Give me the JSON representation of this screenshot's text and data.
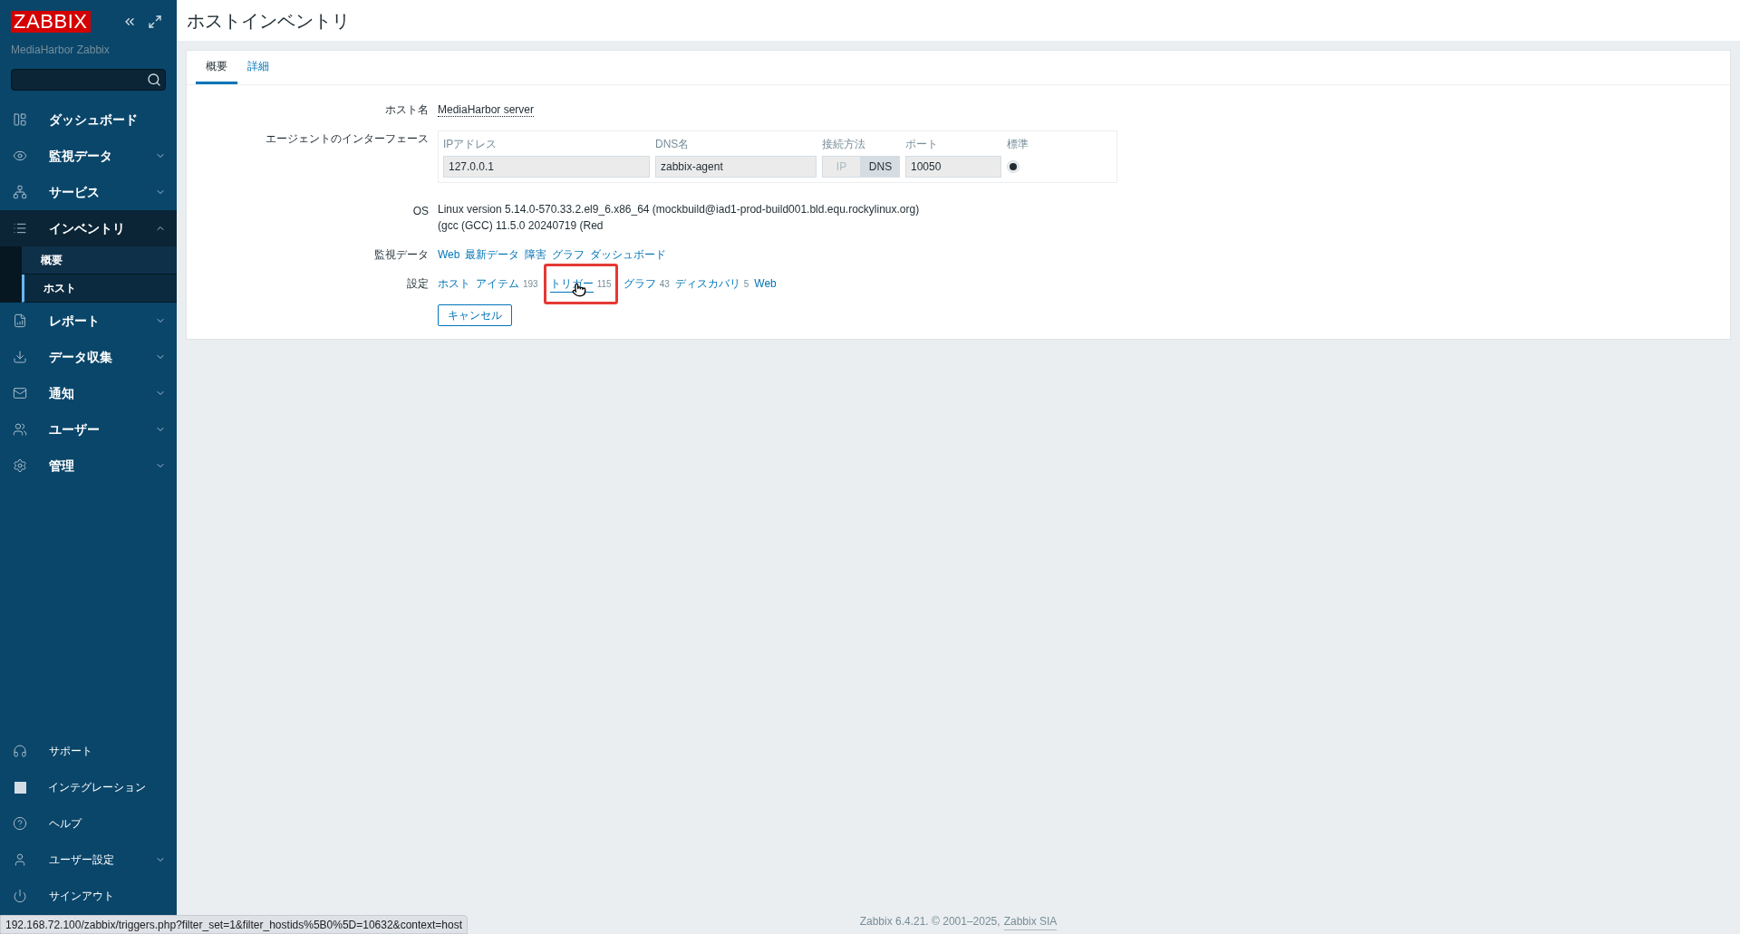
{
  "sidebar": {
    "logo": "ZABBIX",
    "server_name": "MediaHarbor Zabbix",
    "menu": [
      {
        "label": "ダッシュボード",
        "kind": "link"
      },
      {
        "label": "監視データ",
        "kind": "group",
        "expanded": false
      },
      {
        "label": "サービス",
        "kind": "group",
        "expanded": false
      },
      {
        "label": "インベントリ",
        "kind": "group",
        "expanded": true,
        "children": [
          {
            "label": "概要",
            "selected": false
          },
          {
            "label": "ホスト",
            "selected": true
          }
        ]
      },
      {
        "label": "レポート",
        "kind": "group",
        "expanded": false
      },
      {
        "label": "データ収集",
        "kind": "group",
        "expanded": false
      },
      {
        "label": "通知",
        "kind": "group",
        "expanded": false
      },
      {
        "label": "ユーザー",
        "kind": "group",
        "expanded": false
      },
      {
        "label": "管理",
        "kind": "group",
        "expanded": false
      }
    ],
    "bottom": [
      {
        "label": "サポート",
        "kind": "link"
      },
      {
        "label": "インテグレーション",
        "kind": "link"
      },
      {
        "label": "ヘルプ",
        "kind": "link"
      },
      {
        "label": "ユーザー設定",
        "kind": "group",
        "expanded": false
      },
      {
        "label": "サインアウト",
        "kind": "link"
      }
    ]
  },
  "page_title": "ホストインベントリ",
  "tabs": [
    {
      "label": "概要",
      "selected": true
    },
    {
      "label": "詳細",
      "selected": false
    }
  ],
  "host_name": {
    "label": "ホスト名",
    "value": "MediaHarbor server"
  },
  "interface": {
    "label": "エージェントのインターフェース",
    "headers": [
      "IPアドレス",
      "DNS名",
      "接続方法",
      "ポート",
      "標準"
    ],
    "ip": "127.0.0.1",
    "dns": "zabbix-agent",
    "connect_via": [
      {
        "label": "IP",
        "selected": false
      },
      {
        "label": "DNS",
        "selected": true
      }
    ],
    "port": "10050",
    "default": true
  },
  "os": {
    "label": "OS",
    "lines": [
      "Linux version 5.14.0-570.33.2.el9_6.x86_64 (mockbuild@iad1-prod-build001.bld.equ.rockylinux.org)",
      "(gcc (GCC) 11.5.0 20240719 (Red"
    ]
  },
  "monitoring": {
    "label": "監視データ",
    "links": [
      "Web",
      "最新データ",
      "障害",
      "グラフ",
      "ダッシュボード"
    ]
  },
  "configuration": {
    "label": "設定",
    "links": [
      {
        "label": "ホスト",
        "highlighted": false
      },
      {
        "label": "アイテム",
        "count": "193",
        "highlighted": false
      },
      {
        "label": "トリガー",
        "count": "115",
        "highlighted": true
      },
      {
        "label": "グラフ",
        "count": "43",
        "highlighted": false
      },
      {
        "label": "ディスカバリ",
        "count": "5",
        "highlighted": false
      },
      {
        "label": "Web",
        "highlighted": false
      }
    ]
  },
  "cancel_button": "キャンセル",
  "footer": {
    "text": "Zabbix 6.4.21. © 2001–2025,",
    "link": "Zabbix SIA"
  },
  "status_bar": "192.168.72.100/zabbix/triggers.php?filter_set=1&filter_hostids%5B0%5D=10632&context=host"
}
